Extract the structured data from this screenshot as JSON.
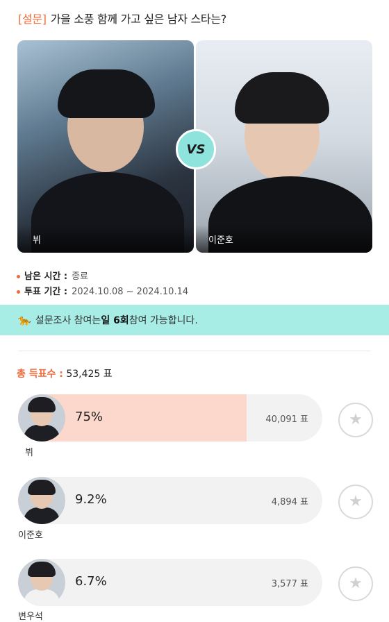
{
  "poll": {
    "tag": "[설문]",
    "question": "가을 소풍 함께 가고 싶은 남자 스타는?",
    "vs_label": "VS",
    "left": {
      "name": "뷔"
    },
    "right": {
      "name": "이준호"
    }
  },
  "info": {
    "remaining_label": "남은 시간 :",
    "remaining_value": "종료",
    "period_label": "투표 기간 :",
    "period_value": "2024.10.08 ~ 2024.10.14"
  },
  "banner": {
    "icon": "🐆",
    "prefix": "설문조사 참여는 ",
    "emphasis": "일 6회",
    "suffix": " 참여 가능합니다."
  },
  "total": {
    "label": "총 득표수 :",
    "value": "53,425 표"
  },
  "candidates": [
    {
      "name": "뷔",
      "percent": "75%",
      "votes": "40,091 표",
      "share": 0.75
    },
    {
      "name": "이준호",
      "percent": "9.2%",
      "votes": "4,894 표",
      "share": 0.092
    },
    {
      "name": "변우석",
      "percent": "6.7%",
      "votes": "3,577 표",
      "share": 0.067
    }
  ],
  "colors": {
    "accent": "#ef6b3b",
    "banner": "#a7ece5",
    "vs_badge": "#8ee3dd",
    "bar_fill": "#fbd8cb"
  },
  "icons": {
    "vote": "star-icon"
  }
}
